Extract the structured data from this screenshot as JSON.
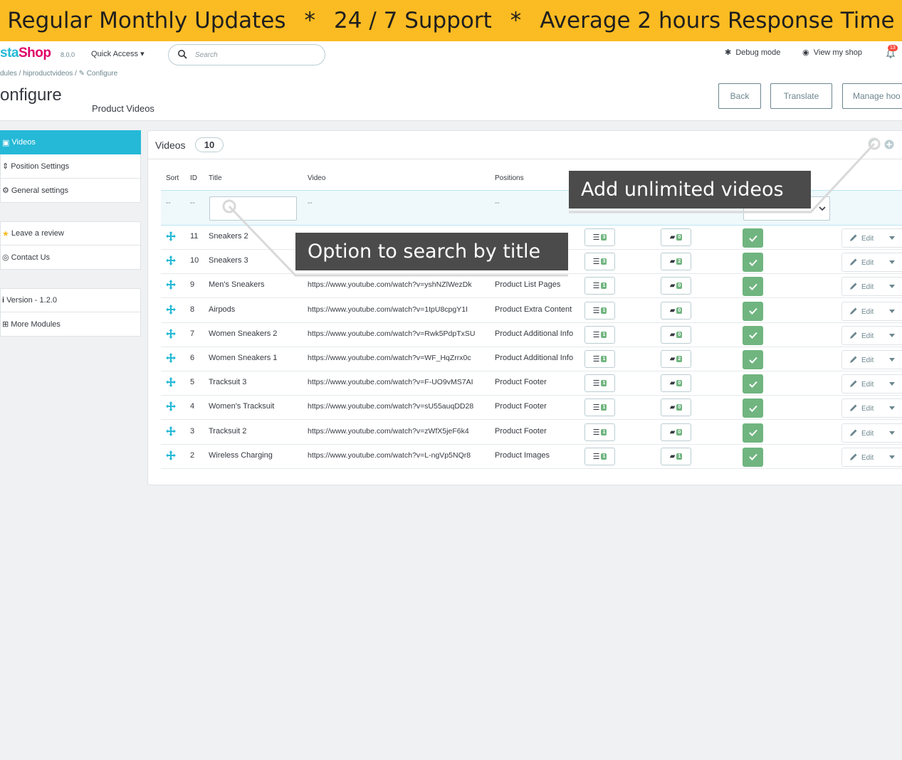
{
  "banner": {
    "item1": "Regular Monthly Updates",
    "sep": "*",
    "item2": "24 / 7 Support",
    "item3": "Average 2 hours Response Time"
  },
  "header": {
    "logo_main": "sta",
    "logo_accent": "Shop",
    "version": "8.0.0",
    "quick_access": "Quick Access",
    "search_placeholder": "Search",
    "debug_mode": "Debug mode",
    "view_shop": "View my shop",
    "notifications_count": "13",
    "breadcrumb": "dules  /  hiproductvideos  /  ",
    "breadcrumb_current": "Configure",
    "page_title": "onfigure",
    "subtitle": "Product Videos",
    "buttons": {
      "back": "Back",
      "translate": "Translate",
      "manage": "Manage hoo"
    }
  },
  "sidebar": {
    "items": [
      {
        "label": "Videos",
        "icon": "camera-icon",
        "active": true
      },
      {
        "label": "Position Settings",
        "icon": "sort-icon"
      },
      {
        "label": "General settings",
        "icon": "gear-icon"
      },
      {
        "label": "Leave a review",
        "icon": "star-icon"
      },
      {
        "label": "Contact Us",
        "icon": "support-icon"
      },
      {
        "label": "Version - 1.2.0",
        "icon": "info-icon"
      },
      {
        "label": "More Modules",
        "icon": "plus-square-icon"
      }
    ]
  },
  "panel": {
    "title": "Videos",
    "count": "10",
    "columns": {
      "sort": "Sort",
      "id": "ID",
      "title": "Title",
      "video": "Video",
      "positions": "Positions"
    },
    "filter_placeholder": "--",
    "rows": [
      {
        "id": "11",
        "title": "Sneakers 2",
        "video": "",
        "position": "",
        "c1": "3",
        "c2": "0"
      },
      {
        "id": "10",
        "title": "Sneakers 3",
        "video": "",
        "position": "",
        "c1": "3",
        "c2": "2"
      },
      {
        "id": "9",
        "title": "Men's Sneakers",
        "video": "https://www.youtube.com/watch?v=yshNZlWezDk",
        "position": "Product List Pages",
        "c1": "1",
        "c2": "0"
      },
      {
        "id": "8",
        "title": "Airpods",
        "video": "https://www.youtube.com/watch?v=1tpU8cpgY1I",
        "position": "Product Extra Content",
        "c1": "1",
        "c2": "0"
      },
      {
        "id": "7",
        "title": "Women Sneakers 2",
        "video": "https://www.youtube.com/watch?v=Rwk5PdpTxSU",
        "position": "Product Additional Info",
        "c1": "1",
        "c2": "0"
      },
      {
        "id": "6",
        "title": "Women Sneakers 1",
        "video": "https://www.youtube.com/watch?v=WF_HqZrrx0c",
        "position": "Product Additional Info",
        "c1": "1",
        "c2": "2"
      },
      {
        "id": "5",
        "title": "Tracksuit 3",
        "video": "https://www.youtube.com/watch?v=F-UO9vMS7AI",
        "position": "Product Footer",
        "c1": "1",
        "c2": "0"
      },
      {
        "id": "4",
        "title": "Women's Tracksuit",
        "video": "https://www.youtube.com/watch?v=sU55auqDD28",
        "position": "Product Footer",
        "c1": "1",
        "c2": "0"
      },
      {
        "id": "3",
        "title": "Tracksuit 2",
        "video": "https://www.youtube.com/watch?v=zWfX5jeF6k4",
        "position": "Product Footer",
        "c1": "1",
        "c2": "0"
      },
      {
        "id": "2",
        "title": "Wireless Charging",
        "video": "https://www.youtube.com/watch?v=L-ngVp5NQr8",
        "position": "Product Images",
        "c1": "1",
        "c2": "1"
      }
    ],
    "edit_label": "Edit"
  },
  "callouts": {
    "add_videos": "Add unlimited videos",
    "search_title": "Option to search by title"
  },
  "colors": {
    "banner": "#fbbb22",
    "brand_blue": "#25b9d7",
    "brand_pink": "#df0067",
    "success": "#70b580",
    "callout_bg": "#4b4b4b"
  }
}
